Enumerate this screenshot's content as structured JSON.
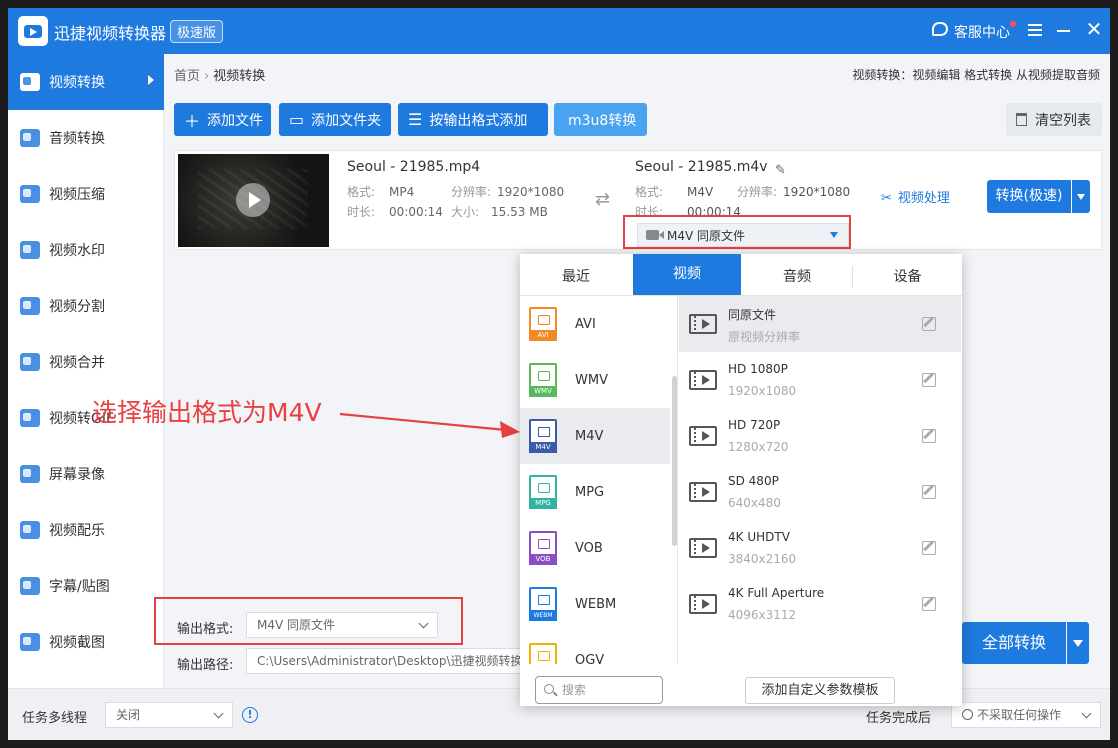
{
  "app": {
    "title": "迅捷视频转换器",
    "edition": "极速版",
    "service": "客服中心"
  },
  "sidebar": {
    "items": [
      {
        "label": "视频转换"
      },
      {
        "label": "音频转换"
      },
      {
        "label": "视频压缩"
      },
      {
        "label": "视频水印"
      },
      {
        "label": "视频分割"
      },
      {
        "label": "视频合并"
      },
      {
        "label": "视频转GIF"
      },
      {
        "label": "屏幕录像"
      },
      {
        "label": "视频配乐"
      },
      {
        "label": "字幕/贴图"
      },
      {
        "label": "视频截图"
      }
    ]
  },
  "breadcrumb": {
    "home": "首页",
    "current": "视频转换"
  },
  "toplinks": "视频转换：视频编辑 格式转换 从视频提取音频",
  "toolbar": {
    "add_file": "添加文件",
    "add_folder": "添加文件夹",
    "add_by_format": "按输出格式添加",
    "m3u8": "m3u8转换",
    "clear": "清空列表"
  },
  "file": {
    "src_name": "Seoul - 21985.mp4",
    "src_format_label": "格式:",
    "src_format": "MP4",
    "src_res_label": "分辨率:",
    "src_res": "1920*1080",
    "src_dur_label": "时长:",
    "src_dur": "00:00:14",
    "src_size_label": "大小:",
    "src_size": "15.53 MB",
    "dst_name": "Seoul - 21985.m4v",
    "dst_format_label": "格式:",
    "dst_format": "M4V",
    "dst_res_label": "分辨率:",
    "dst_res": "1920*1080",
    "dst_dur_label": "时长:",
    "dst_dur": "00:00:14",
    "format_select": "M4V  同原文件",
    "process": "视频处理",
    "convert": "转换(极速)"
  },
  "popup": {
    "tabs": [
      "最近",
      "视频",
      "音频",
      "设备"
    ],
    "formats": [
      {
        "name": "AVI",
        "color": "#f08a24"
      },
      {
        "name": "WMV",
        "color": "#5cb85c"
      },
      {
        "name": "M4V",
        "color": "#3b5ba9"
      },
      {
        "name": "MPG",
        "color": "#2fb4a0"
      },
      {
        "name": "VOB",
        "color": "#8a4fc7"
      },
      {
        "name": "WEBM",
        "color": "#1f7ae0"
      },
      {
        "name": "OGV",
        "color": "#f0b400"
      }
    ],
    "resolutions": [
      {
        "name": "同原文件",
        "sub": "原视频分辨率"
      },
      {
        "name": "HD 1080P",
        "sub": "1920x1080"
      },
      {
        "name": "HD 720P",
        "sub": "1280x720"
      },
      {
        "name": "SD 480P",
        "sub": "640x480"
      },
      {
        "name": "4K UHDTV",
        "sub": "3840x2160"
      },
      {
        "name": "4K Full Aperture",
        "sub": "4096x3112"
      }
    ],
    "search_placeholder": "搜索",
    "custom_template": "添加自定义参数模板"
  },
  "bottom": {
    "output_format_label": "输出格式:",
    "output_format": "M4V  同原文件",
    "output_path_label": "输出路径:",
    "output_path": "C:\\Users\\Administrator\\Desktop\\迅捷视频转换",
    "convert_all": "全部转换"
  },
  "statusbar": {
    "multithread_label": "任务多线程",
    "multithread_value": "关闭",
    "after_label": "任务完成后",
    "after_value": "不采取任何操作"
  },
  "annotation": "选择输出格式为M4V",
  "colors": {
    "accent": "#1f7ae0",
    "highlight": "#e84040"
  }
}
